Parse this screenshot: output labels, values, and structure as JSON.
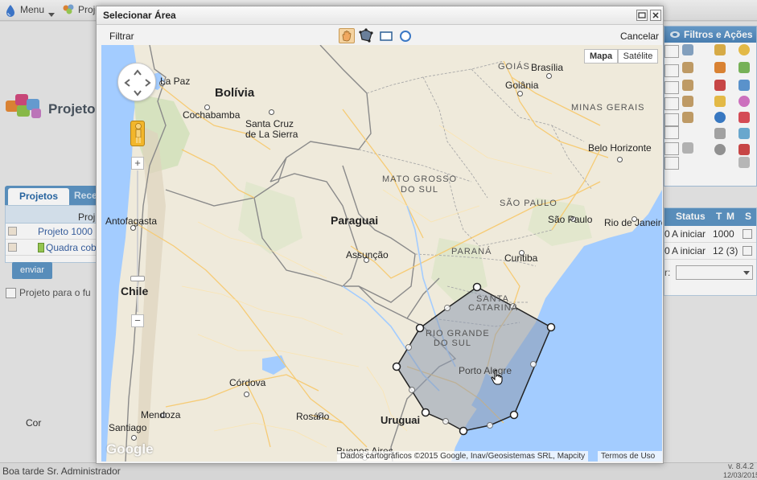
{
  "topbar": {
    "menu_label": "Menu",
    "projects_label": "Proje"
  },
  "app": {
    "logo_text": "Projeto"
  },
  "left": {
    "tabs": [
      {
        "label": "Projetos"
      },
      {
        "label": "Rece"
      }
    ],
    "columns": {
      "cor": "Cor",
      "proj": "Proj"
    },
    "rows": [
      {
        "name": "Projeto 1000"
      },
      {
        "name": "Quadra cob"
      }
    ],
    "submit_label": "enviar",
    "future_checkbox_label": "Projeto para o fu"
  },
  "right_panel": {
    "title": "Filtros e Ações"
  },
  "right_grid": {
    "columns": {
      "status": "Status",
      "t": "T",
      "m": "M",
      "s": "S"
    },
    "rows": [
      {
        "prefix": "0",
        "status": "A iniciar",
        "tm": "1000"
      },
      {
        "prefix": "0",
        "status": "A iniciar",
        "tm": "12 (3)"
      }
    ],
    "filter_label": "r:"
  },
  "footer": {
    "greeting": "Boa tarde Sr. Administrador",
    "version": "v. 8.4.2",
    "date": "12/03/2015"
  },
  "modal": {
    "title": "Selecionar Área",
    "filter_label": "Filtrar",
    "cancel_label": "Cancelar",
    "tools": [
      "hand-tool",
      "polygon-tool",
      "rectangle-tool",
      "circle-tool"
    ]
  },
  "map": {
    "map_button": "Mapa",
    "satellite_button": "Satélite",
    "attribution": "Dados cartográficos ©2015 Google, Inav/Geosistemas SRL, Mapcity",
    "terms": "Termos de Uso",
    "logo": "Google",
    "zoom_in": "+",
    "zoom_out": "−",
    "countries": [
      "Bolívia",
      "Paraguai",
      "Chile",
      "Uruguai"
    ],
    "states": [
      "GOIÁS",
      "MINAS GERAIS",
      "MATO GROSSO",
      "DO SUL",
      "SÃO PAULO",
      "PARANÁ",
      "SANTA",
      "CATARINA",
      "RIO GRANDE",
      "DO SUL"
    ],
    "cities": [
      "La Paz",
      "Cochabamba",
      "Santa Cruz",
      "de La Sierra",
      "Brasília",
      "Goiânia",
      "Belo Horizonte",
      "São Paulo",
      "Rio de Janeiro",
      "Curitiba",
      "Assunção",
      "Antofagasta",
      "Porto Alegre",
      "Córdova",
      "Rosário",
      "Mendoza",
      "Santiago",
      "Buenos Aires"
    ]
  },
  "colors": {
    "accent": "#5d95c4",
    "ocean": "#a3ccff",
    "land": "#efeadb",
    "polygon_fill": "#8e9bb0"
  }
}
